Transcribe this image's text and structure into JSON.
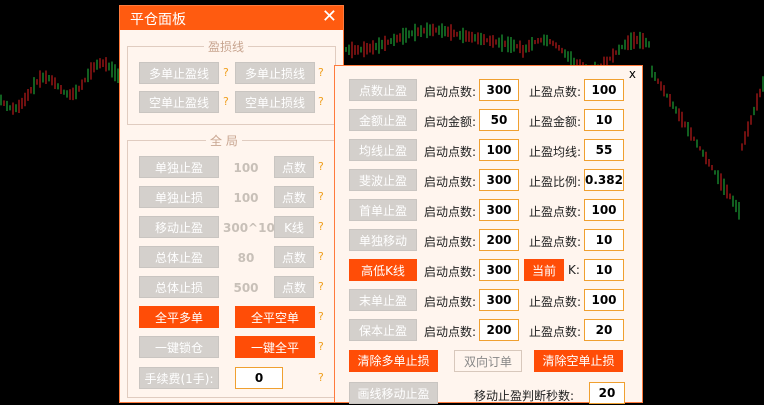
{
  "chart_data": {
    "type": "candlestick",
    "background": "#000000",
    "up_color": "#22c040",
    "down_color": "#e02020"
  },
  "panel1": {
    "title": "平仓面板",
    "close_symbol": "✕",
    "help_symbol": "?",
    "sl_group": {
      "title": "盈损线",
      "multi_tp_line": "多单止盈线",
      "multi_sl_line": "多单止损线",
      "short_tp_line": "空单止盈线",
      "short_sl_line": "空单止损线"
    },
    "global_group": {
      "title": "全 局",
      "single_tp": "单独止盈",
      "single_tp_value": "100",
      "single_tp_unit": "点数",
      "single_sl": "单独止损",
      "single_sl_value": "100",
      "single_sl_unit": "点数",
      "trailing_tp": "移动止盈",
      "trailing_tp_value": "300^10",
      "trailing_tp_unit": "K线",
      "total_tp": "总体止盈",
      "total_tp_value": "80",
      "total_tp_unit": "点数",
      "total_sl": "总体止损",
      "total_sl_value": "500",
      "total_sl_unit": "点数",
      "close_all_long": "全平多单",
      "close_all_short": "全平空单",
      "lock_position": "一键锁仓",
      "close_all": "一键全平",
      "fee_label": "手续费(1手):",
      "fee_value": "0"
    }
  },
  "panel2": {
    "close_symbol": "x",
    "rows": [
      {
        "btn": "点数止盈",
        "l1": "启动点数:",
        "v1": "300",
        "l2": "止盈点数:",
        "v2": "100",
        "red": false
      },
      {
        "btn": "金额止盈",
        "l1": "启动金额:",
        "v1": "50",
        "l2": "止盈金额:",
        "v2": "10",
        "red": false
      },
      {
        "btn": "均线止盈",
        "l1": "启动点数:",
        "v1": "100",
        "l2": "止盈均线:",
        "v2": "55",
        "red": false
      },
      {
        "btn": "斐波止盈",
        "l1": "启动点数:",
        "v1": "300",
        "l2": "止盈比例:",
        "v2": "0.382",
        "red": false
      },
      {
        "btn": "首单止盈",
        "l1": "启动点数:",
        "v1": "300",
        "l2": "止盈点数:",
        "v2": "100",
        "red": false
      },
      {
        "btn": "单独移动",
        "l1": "启动点数:",
        "v1": "200",
        "l2": "止盈点数:",
        "v2": "10",
        "red": false
      },
      {
        "btn": "高低K线",
        "l1": "启动点数:",
        "v1": "300",
        "l2": "K:",
        "v2": "10",
        "red": true,
        "extra": "当前"
      },
      {
        "btn": "末单止盈",
        "l1": "启动点数:",
        "v1": "300",
        "l2": "止盈点数:",
        "v2": "100",
        "red": false
      },
      {
        "btn": "保本止盈",
        "l1": "启动点数:",
        "v1": "200",
        "l2": "止盈点数:",
        "v2": "20",
        "red": false
      }
    ],
    "clear_long_sl": "清除多单止损",
    "dual_order": "双向订单",
    "clear_short_sl": "清除空单止损",
    "draw_trailing": "画线移动止盈",
    "trailing_seconds_label": "移动止盈判断秒数:",
    "trailing_seconds_value": "20"
  }
}
